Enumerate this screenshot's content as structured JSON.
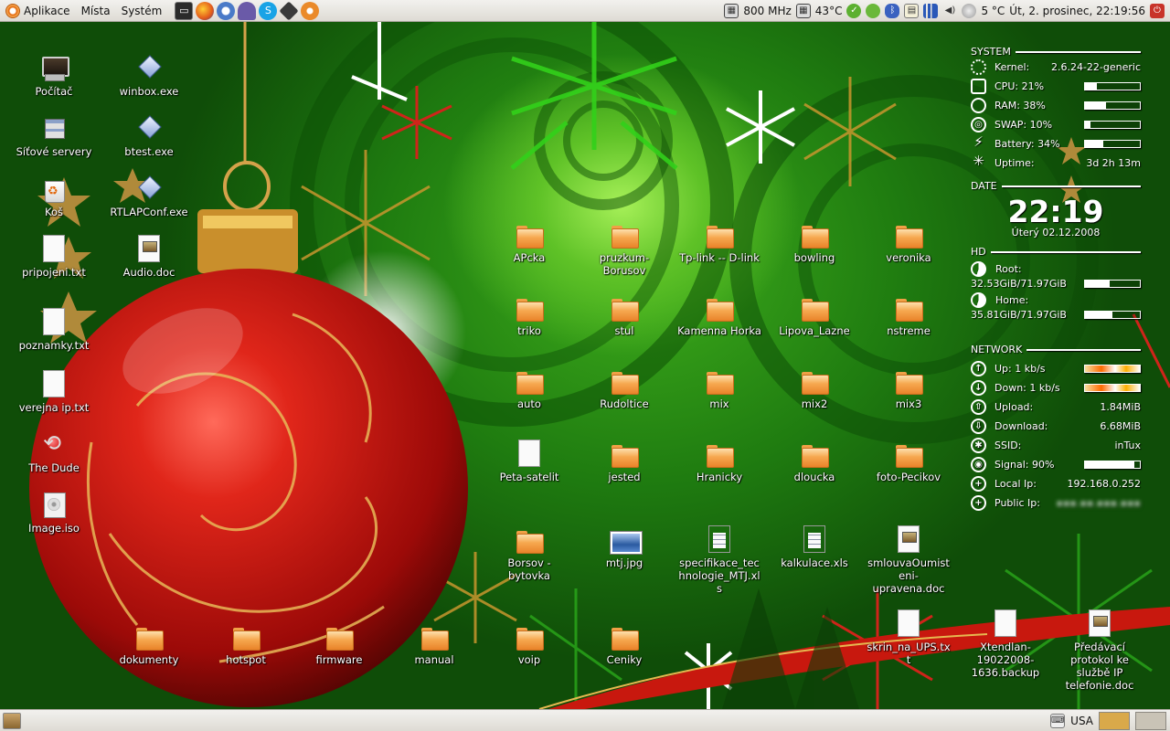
{
  "top_panel": {
    "menus": [
      "Aplikace",
      "Místa",
      "Systém"
    ],
    "tray": {
      "cpu_freq": "800 MHz",
      "cpu_temp": "43°C",
      "weather": "5 °C",
      "datetime": "Út,  2. prosinec, 22:19:56"
    }
  },
  "bottom_panel": {
    "keyboard_layout": "USA"
  },
  "desktop": {
    "left_column": [
      {
        "label": "Počítač",
        "type": "computer"
      },
      {
        "label": "Síťové servery",
        "type": "server"
      },
      {
        "label": "Koš",
        "type": "trash"
      },
      {
        "label": "pripojeni.txt",
        "type": "doc"
      },
      {
        "label": "poznamky.txt",
        "type": "doc"
      },
      {
        "label": "verejna ip.txt",
        "type": "doc"
      },
      {
        "label": "The Dude",
        "type": "dude"
      },
      {
        "label": "Image.iso",
        "type": "iso"
      }
    ],
    "second_column": [
      {
        "label": "winbox.exe",
        "type": "exe"
      },
      {
        "label": "btest.exe",
        "type": "exe"
      },
      {
        "label": "RTLAPConf.exe",
        "type": "exe"
      },
      {
        "label": "Audio.doc",
        "type": "doc-pic"
      }
    ],
    "grid": [
      [
        "APcka",
        "pruzkum-Borusov",
        "Tp-link -- D-link",
        "bowling",
        "veronika"
      ],
      [
        "triko",
        "stul",
        "Kamenna Horka",
        "Lipova_Lazne",
        "nstreme"
      ],
      [
        "auto",
        "Rudoltice",
        "mix",
        "mix2",
        "mix3"
      ],
      [
        "Peta-satelit",
        "jested",
        "Hranicky",
        "dloucka",
        "foto-Pecikov"
      ],
      [
        "Borsov - bytovka",
        "mtj.jpg",
        "specifikace_technologie_MTJ.xls",
        "kalkulace.xls",
        "smlouvaOumisteni-upravena.doc"
      ]
    ],
    "bottom_row": [
      "dokumenty",
      "hotspot",
      "firmware",
      "manual",
      "voip",
      "Ceniky"
    ],
    "bottom_right": [
      "skrin_na_UPS.txt",
      "Xtendlan-19022008-1636.backup",
      "Předávací protokol ke službě IP telefonie.doc"
    ]
  },
  "conky": {
    "system_title": "SYSTEM",
    "kernel_label": "Kernel:",
    "kernel_value": "2.6.24-22-generic",
    "cpu_label": "CPU: 21%",
    "cpu_level": 0.21,
    "ram_label": "RAM: 38%",
    "ram_level": 0.38,
    "swap_label": "SWAP: 10%",
    "swap_level": 0.1,
    "battery_label": "Battery: 34%",
    "battery_level": 0.34,
    "uptime_label": "Uptime:",
    "uptime_value": "3d 2h 13m",
    "date_title": "DATE",
    "clock": "22:19",
    "date": "Úterý 02.12.2008",
    "hd_title": "HD",
    "root_label": "Root:",
    "root_value": "32.53GiB/71.97GiB",
    "root_level": 0.45,
    "home_label": "Home:",
    "home_value": "35.81GiB/71.97GiB",
    "home_level": 0.5,
    "network_title": "NETWORK",
    "up_label": "Up: 1 kb/s",
    "down_label": "Down: 1 kb/s",
    "upload_label": "Upload:",
    "upload_value": "1.84MiB",
    "download_label": "Download:",
    "download_value": "6.68MiB",
    "ssid_label": "SSID:",
    "ssid_value": "inTux",
    "signal_label": "Signal: 90%",
    "signal_level": 0.9,
    "localip_label": "Local Ip:",
    "localip_value": "192.168.0.252",
    "publicip_label": "Public Ip:"
  }
}
